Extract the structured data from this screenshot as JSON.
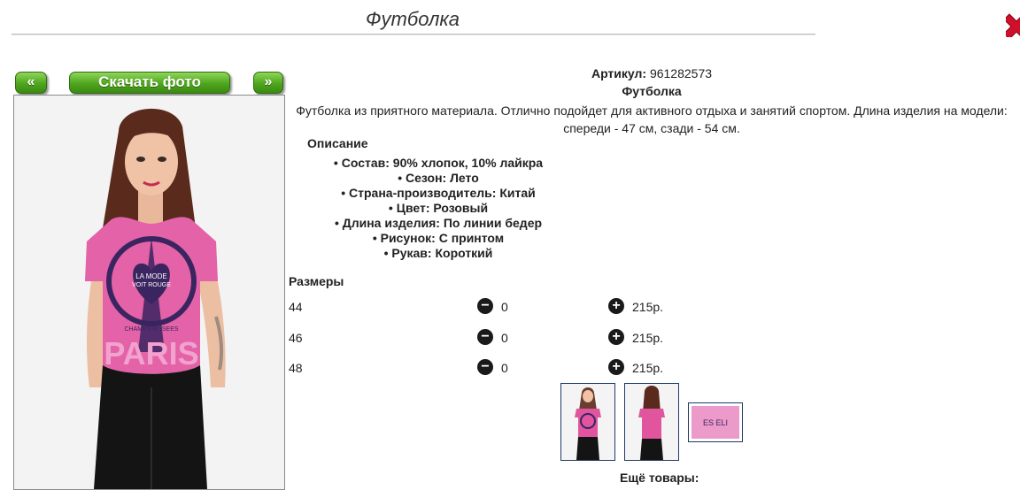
{
  "page": {
    "title": "Футболка"
  },
  "nav": {
    "prev_label": "«",
    "download_label": "Скачать фото",
    "next_label": "»"
  },
  "product": {
    "article_label": "Артикул:",
    "article_value": "961282573",
    "name": "Футболка",
    "description": "Футболка из приятного материала. Отлично подойдет для активного отдыха и занятий спортом. Длина изделия на модели: спереди - 47 см, сзади - 54 см.",
    "desc_heading": "Описание",
    "attributes": [
      "Состав: 90% хлопок, 10% лайкра",
      "Сезон: Лето",
      "Страна-производитель: Китай",
      "Цвет: Розовый",
      "Длина изделия: По линии бедер",
      "Рисунок: С принтом",
      "Рукав: Короткий"
    ],
    "photo_print": {
      "line1": "LA MODE",
      "line2": "VOIT ROUGE",
      "word": "PARIS",
      "band": "CHAMPS ELISEES"
    }
  },
  "sizes": {
    "heading": "Размеры",
    "rows": [
      {
        "size": "44",
        "qty": "0",
        "price": "215р."
      },
      {
        "size": "46",
        "qty": "0",
        "price": "215р."
      },
      {
        "size": "48",
        "qty": "0",
        "price": "215р."
      }
    ]
  },
  "thumbs": {
    "detail_text": "ES ELI"
  },
  "more": {
    "title": "Ещё товары:"
  },
  "colors": {
    "accent_green": "#4ea51d",
    "shirt_pink": "#e0559e",
    "close_red": "#d0102a"
  }
}
